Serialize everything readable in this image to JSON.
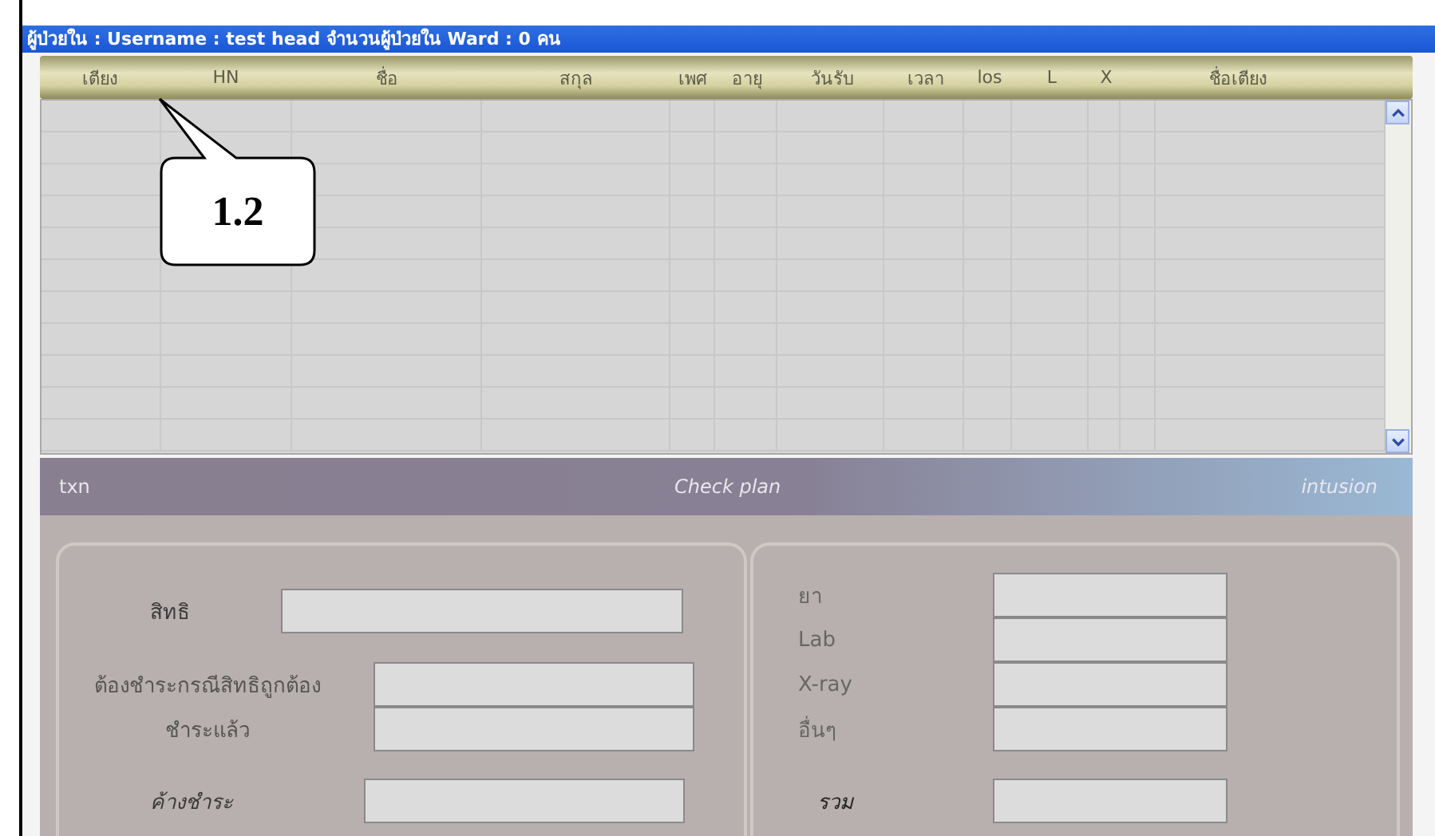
{
  "window": {
    "title": "ผู้ป่วยใน :  Username : test  head  จำนวนผู้ป่วยใน Ward : 0 คน"
  },
  "table": {
    "columns": [
      {
        "label": "เตียง"
      },
      {
        "label": "HN"
      },
      {
        "label": "ชื่อ"
      },
      {
        "label": "สกุล"
      },
      {
        "label": "เพศ"
      },
      {
        "label": "อายุ"
      },
      {
        "label": "วันรับ"
      },
      {
        "label": "เวลา"
      },
      {
        "label": "los"
      },
      {
        "label": "L"
      },
      {
        "label": "X"
      },
      {
        "label": "ชื่อเตียง"
      }
    ]
  },
  "callout": {
    "text": "1.2"
  },
  "panel": {
    "header": {
      "left": "txn",
      "center": "Check plan",
      "right": "intusion"
    },
    "left_group": {
      "fields": [
        {
          "label": "สิทธิ",
          "kind": "wide"
        },
        {
          "label": "ต้องชำระกรณีสิทธิถูกต้อง",
          "kind": "stacked"
        },
        {
          "label": "ชำระแล้ว",
          "kind": "stacked"
        },
        {
          "label": "ค้างชำระ",
          "kind": "total"
        }
      ]
    },
    "right_group": {
      "fields": [
        {
          "label": "ยา",
          "kind": "stacked"
        },
        {
          "label": "Lab",
          "kind": "stacked"
        },
        {
          "label": "X-ray",
          "kind": "stacked"
        },
        {
          "label": "อื่นๆ",
          "kind": "stacked"
        },
        {
          "label": "รวม",
          "kind": "total"
        }
      ]
    }
  }
}
